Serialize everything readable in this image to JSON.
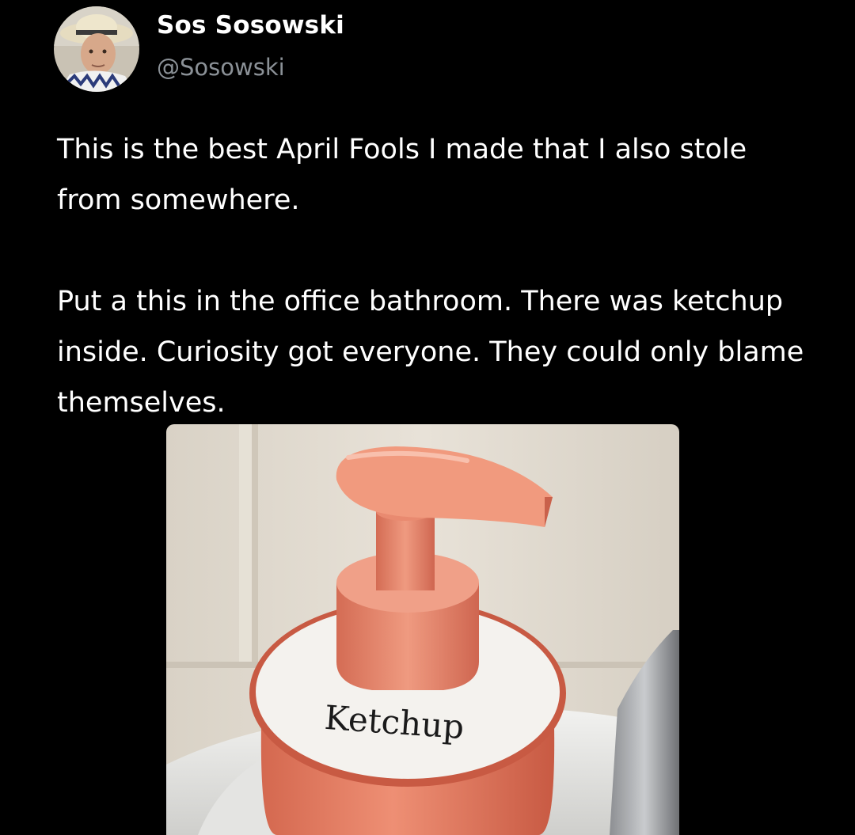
{
  "author": {
    "display_name": "Sos Sosowski",
    "handle": "@Sosowski"
  },
  "tweet": {
    "paragraph_1": "This is the best April Fools I made that I also stole from somewhere.",
    "paragraph_2": "Put a this in the office bathroom. There was ketchup inside. Curiosity got everyone. They could only blame themselves."
  },
  "media": {
    "label_text": "Ketchup"
  },
  "colors": {
    "background": "#000000",
    "text_primary": "#ffffff",
    "text_secondary": "#8b9197",
    "dispenser": "#e07a5f"
  },
  "icons": [
    "avatar-photo"
  ]
}
